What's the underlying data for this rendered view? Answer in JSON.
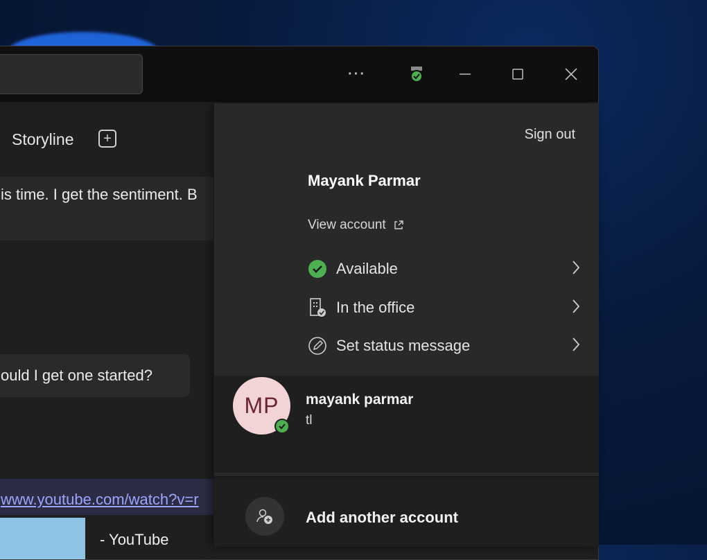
{
  "window": {
    "more_label": "···"
  },
  "tabs": {
    "storyline": "Storyline",
    "add": "+"
  },
  "chat": {
    "message1": "is time. I get the sentiment. B",
    "message2": "ould I get one started?",
    "link": "www.youtube.com/watch?v=r",
    "link_title": "- YouTube"
  },
  "flyout": {
    "sign_out": "Sign out",
    "display_name": "Mayank Parmar",
    "view_account": "View account",
    "status_items": [
      {
        "label": "Available",
        "icon": "available-check-icon"
      },
      {
        "label": "In the office",
        "icon": "building-icon"
      },
      {
        "label": "Set status message",
        "icon": "edit-status-icon"
      }
    ],
    "account": {
      "initials": "MP",
      "name": "mayank parmar",
      "subtitle": "tl"
    },
    "add_account": "Add another account"
  },
  "colors": {
    "available": "#4caf50",
    "accent_link": "#9aa6ff",
    "avatar_bg": "#f2d4d7"
  }
}
